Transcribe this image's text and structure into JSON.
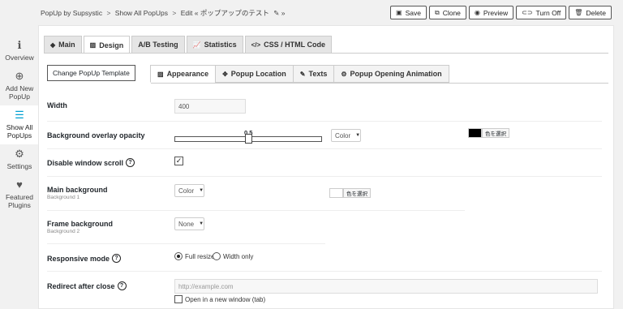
{
  "breadcrumb": {
    "plugin": "PopUp by Supsystic",
    "sep1": ">",
    "all_popups": "Show All PopUps",
    "sep2": ">",
    "edit": "Edit",
    "popup_name": "« ポップアップのテスト",
    "pencil_icon": "✎",
    "end": "»"
  },
  "actions": [
    {
      "label": "Save",
      "icon": "save-icon",
      "glyph": "▣"
    },
    {
      "label": "Clone",
      "icon": "clone-icon",
      "glyph": "⧉"
    },
    {
      "label": "Preview",
      "icon": "eye-icon",
      "glyph": "◉"
    },
    {
      "label": "Turn Off",
      "icon": "toggle-icon",
      "glyph": "⊂⊃"
    },
    {
      "label": "Delete",
      "icon": "trash-icon",
      "glyph": "🗑"
    }
  ],
  "sidebar": {
    "items": [
      {
        "label": "Overview",
        "icon": "info-icon",
        "glyph": "ℹ"
      },
      {
        "label": "Add New PopUp",
        "icon": "plus-circle-icon",
        "glyph": "⊕"
      },
      {
        "label": "Show All PopUps",
        "icon": "list-icon",
        "glyph": "☰"
      },
      {
        "label": "Settings",
        "icon": "gear-icon",
        "glyph": "⚙"
      },
      {
        "label": "Featured Plugins",
        "icon": "heart-icon",
        "glyph": "♥"
      }
    ],
    "active_index": 2
  },
  "main_tabs": [
    {
      "label": "Main",
      "icon": "cube-icon",
      "glyph": "◆"
    },
    {
      "label": "Design",
      "icon": "image-icon",
      "glyph": "▨"
    },
    {
      "label": "A/B Testing",
      "icon": "",
      "glyph": ""
    },
    {
      "label": "Statistics",
      "icon": "chart-icon",
      "glyph": "📈"
    },
    {
      "label": "CSS / HTML Code",
      "icon": "code-icon",
      "glyph": "</>"
    }
  ],
  "main_tabs_active": 1,
  "change_template_label": "Change PopUp Template",
  "sub_tabs": [
    {
      "label": "Appearance",
      "icon": "image-icon",
      "glyph": "▨"
    },
    {
      "label": "Popup Location",
      "icon": "move-icon",
      "glyph": "✥"
    },
    {
      "label": "Texts",
      "icon": "edit-icon",
      "glyph": "✎"
    },
    {
      "label": "Popup Opening Animation",
      "icon": "gear-icon",
      "glyph": "⚙"
    }
  ],
  "sub_tabs_active": 0,
  "settings": {
    "width": {
      "label": "Width",
      "value": "400"
    },
    "overlay": {
      "label": "Background overlay opacity",
      "value": "0.5",
      "level": 0.5,
      "type_value": "Color",
      "color_hex": "#000000",
      "color_button": "色を選択"
    },
    "disable_scroll": {
      "label": "Disable window scroll",
      "checked": true,
      "check_glyph": "✓"
    },
    "main_bg": {
      "label": "Main background",
      "sublabel": "Background 1",
      "type_value": "Color",
      "color_hex": "#ffffff",
      "color_button": "色を選択"
    },
    "frame_bg": {
      "label": "Frame background",
      "sublabel": "Background 2",
      "type_value": "None"
    },
    "responsive": {
      "label": "Responsive mode",
      "options": [
        "Full resize",
        "Width only"
      ],
      "selected": 0
    },
    "redirect": {
      "label": "Redirect after close",
      "placeholder": "http://example.com",
      "new_window_label": "Open in a new window (tab)"
    }
  },
  "colors": {
    "accent": "#00a0d2"
  }
}
